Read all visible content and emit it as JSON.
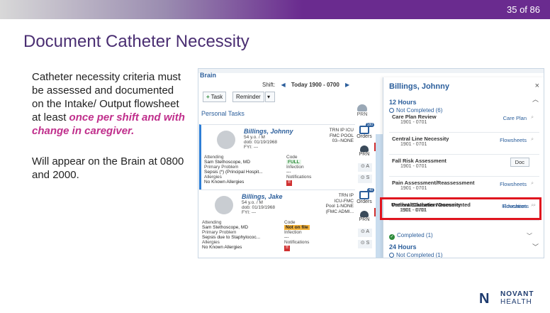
{
  "slide": {
    "number": "35 of 86",
    "title": "Document Catheter Necessity",
    "para1_lead": "Catheter necessity criteria must be assessed and documented on the Intake/ Output flowsheet at least ",
    "para1_highlight": "once per shift and with change in caregiver.",
    "para2": "Will appear on the Brain at 0800 and 2000.",
    "logo_mark": "N",
    "logo_word1": "NOVANT",
    "logo_word2": "HEALTH"
  },
  "app": {
    "brain_label": "Brain",
    "shift_label": "Shift:",
    "prev_arrow": "◀",
    "today_label": "Today",
    "shift_range": "1900 - 0700",
    "next_arrow": "▶",
    "task_button": "Task",
    "reminder_button": "Reminder",
    "dropdown_arrow": "▾",
    "personal_tasks": "Personal Tasks",
    "prn": "PRN",
    "patients": [
      {
        "name": "Billings, Johnny",
        "age_sex": "54 y.o. / M",
        "dob": "dob: 01/19/1968",
        "fyi": "FYI: ---",
        "location": "TRN IP ICU\nFMC POOL\n03--NONE",
        "attending_label": "Attending",
        "attending": "Sam Stethoscope, MD",
        "problem_label": "Primary Problem",
        "problem": "Sepsis (*) (Principal Hospit...",
        "allergies_label": "Allergies",
        "allergies": "No Known Allergies",
        "code_label": "Code",
        "code": "FULL",
        "infection_label": "Infection",
        "infection": "---",
        "notifications_label": "Notifications",
        "badge": "180",
        "orders": "Orders",
        "prn": "PRN",
        "mini_a": "A",
        "mini_s": "S"
      },
      {
        "name": "Billings, Jake",
        "age_sex": "54 y.o. / M",
        "dob": "dob: 01/19/1968",
        "fyi": "FYI: ---",
        "location": "TRN IP\nICU-FMC\nPool 1-NONE\n(FMC ADMI...",
        "attending_label": "Attending",
        "attending": "Sam Stethoscope, MD",
        "problem_label": "Primary Problem",
        "problem": "Sepsis due to Staphylococ...",
        "allergies_label": "Allergies",
        "allergies": "No Known Allergies",
        "code_label": "Code",
        "code": "Not on file",
        "infection_label": "Infection",
        "infection": "---",
        "notifications_label": "Notifications",
        "badge": "48",
        "orders": "Orders",
        "prn": "PRN",
        "mini_a": "A",
        "mini_s": "S"
      }
    ],
    "panel": {
      "title": "Billings, Johnny",
      "close": "×",
      "section1": "12 Hours",
      "not_completed": "Not Completed (6)",
      "tasks": [
        {
          "name": "Care Plan Review",
          "time": "1901 - 0701",
          "action": "Care Plan"
        },
        {
          "name": "Central Line Necessity",
          "time": "1901 - 0701",
          "action": "Flowsheets"
        },
        {
          "name": "Fall Risk Assessment",
          "time": "1901 - 0701",
          "action": "Doc"
        },
        {
          "name": "Pain Assessment/Reassessment",
          "time": "1901 - 0701",
          "action": "Flowsheets"
        },
        {
          "name": "Patient Education Documented",
          "time": "1901 - 0701",
          "action": "Education"
        },
        {
          "name": "Urethral Catheter Necessity",
          "time": "1901 - 0701",
          "action": "Flowsheets"
        }
      ],
      "completed": "Completed (1)",
      "section2": "24 Hours",
      "not_completed2": "Not Completed (1)"
    }
  }
}
